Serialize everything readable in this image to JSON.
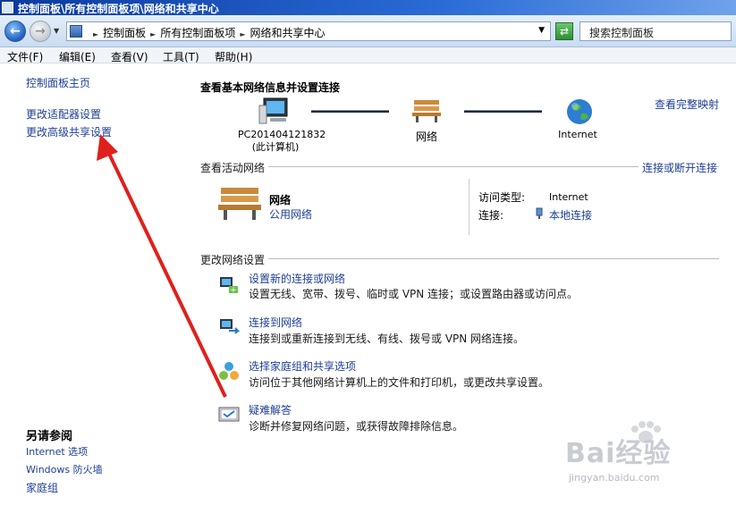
{
  "window": {
    "title": "控制面板\\所有控制面板项\\网络和共享中心"
  },
  "address_bar": {
    "crumbs": [
      "控制面板",
      "所有控制面板项",
      "网络和共享中心"
    ],
    "search_placeholder": "搜索控制面板"
  },
  "menu": [
    "文件(F)",
    "编辑(E)",
    "查看(V)",
    "工具(T)",
    "帮助(H)"
  ],
  "sidebar": {
    "home": "控制面板主页",
    "links": [
      "更改适配器设置",
      "更改高级共享设置"
    ],
    "see_also_title": "另请参阅",
    "see_also": [
      "Internet 选项",
      "Windows 防火墙",
      "家庭组"
    ]
  },
  "main": {
    "heading": "查看基本网络信息并设置连接",
    "full_map": "查看完整映射",
    "map": {
      "computer_name": "PC201404121832",
      "computer_sub": "(此计算机)",
      "network": "网络",
      "internet": "Internet"
    },
    "active": {
      "title": "查看活动网络",
      "connect_link": "连接或断开连接",
      "network_name": "网络",
      "network_type": "公用网络",
      "access_type_label": "访问类型:",
      "access_type_value": "Internet",
      "connection_label": "连接:",
      "connection_value": "本地连接"
    },
    "change": {
      "title": "更改网络设置",
      "tasks": [
        {
          "title": "设置新的连接或网络",
          "desc": "设置无线、宽带、拨号、临时或 VPN 连接；或设置路由器或访问点。",
          "icon": "new-connection-icon"
        },
        {
          "title": "连接到网络",
          "desc": "连接到或重新连接到无线、有线、拨号或 VPN 网络连接。",
          "icon": "connect-network-icon"
        },
        {
          "title": "选择家庭组和共享选项",
          "desc": "访问位于其他网络计算机上的文件和打印机，或更改共享设置。",
          "icon": "homegroup-icon"
        },
        {
          "title": "疑难解答",
          "desc": "诊断并修复网络问题，或获得故障排除信息。",
          "icon": "troubleshoot-icon"
        }
      ]
    }
  },
  "watermark": {
    "brand": "Bai经验",
    "url": "jingyan.baidu.com"
  },
  "colors": {
    "link": "#1d3f96",
    "arrow": "#e0201c",
    "titlebar": "#0b3a9e"
  }
}
